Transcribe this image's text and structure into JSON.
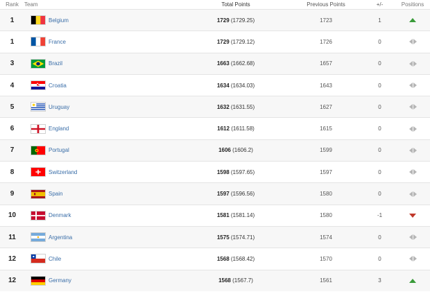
{
  "headers": {
    "rank": "Rank",
    "team": "Team",
    "total_points": "Total Points",
    "previous_points": "Previous Points",
    "diff": "+/-",
    "positions": "Positions"
  },
  "rows": [
    {
      "rank": "1",
      "team": "Belgium",
      "flag": "belgium",
      "points": "1729",
      "exact": "(1729.25)",
      "previous": "1723",
      "diff": "1",
      "movement": "up"
    },
    {
      "rank": "1",
      "team": "France",
      "flag": "france",
      "points": "1729",
      "exact": "(1729.12)",
      "previous": "1726",
      "diff": "0",
      "movement": "same"
    },
    {
      "rank": "3",
      "team": "Brazil",
      "flag": "brazil",
      "points": "1663",
      "exact": "(1662.68)",
      "previous": "1657",
      "diff": "0",
      "movement": "same"
    },
    {
      "rank": "4",
      "team": "Croatia",
      "flag": "croatia",
      "points": "1634",
      "exact": "(1634.03)",
      "previous": "1643",
      "diff": "0",
      "movement": "same"
    },
    {
      "rank": "5",
      "team": "Uruguay",
      "flag": "uruguay",
      "points": "1632",
      "exact": "(1631.55)",
      "previous": "1627",
      "diff": "0",
      "movement": "same"
    },
    {
      "rank": "6",
      "team": "England",
      "flag": "england",
      "points": "1612",
      "exact": "(1611.58)",
      "previous": "1615",
      "diff": "0",
      "movement": "same"
    },
    {
      "rank": "7",
      "team": "Portugal",
      "flag": "portugal",
      "points": "1606",
      "exact": "(1606.2)",
      "previous": "1599",
      "diff": "0",
      "movement": "same"
    },
    {
      "rank": "8",
      "team": "Switzerland",
      "flag": "switzerland",
      "points": "1598",
      "exact": "(1597.65)",
      "previous": "1597",
      "diff": "0",
      "movement": "same"
    },
    {
      "rank": "9",
      "team": "Spain",
      "flag": "spain",
      "points": "1597",
      "exact": "(1596.56)",
      "previous": "1580",
      "diff": "0",
      "movement": "same"
    },
    {
      "rank": "10",
      "team": "Denmark",
      "flag": "denmark",
      "points": "1581",
      "exact": "(1581.14)",
      "previous": "1580",
      "diff": "-1",
      "movement": "down"
    },
    {
      "rank": "11",
      "team": "Argentina",
      "flag": "argentina",
      "points": "1575",
      "exact": "(1574.71)",
      "previous": "1574",
      "diff": "0",
      "movement": "same"
    },
    {
      "rank": "12",
      "team": "Chile",
      "flag": "chile",
      "points": "1568",
      "exact": "(1568.42)",
      "previous": "1570",
      "diff": "0",
      "movement": "same"
    },
    {
      "rank": "12",
      "team": "Germany",
      "flag": "germany",
      "points": "1568",
      "exact": "(1567.7)",
      "previous": "1561",
      "diff": "3",
      "movement": "up"
    }
  ]
}
